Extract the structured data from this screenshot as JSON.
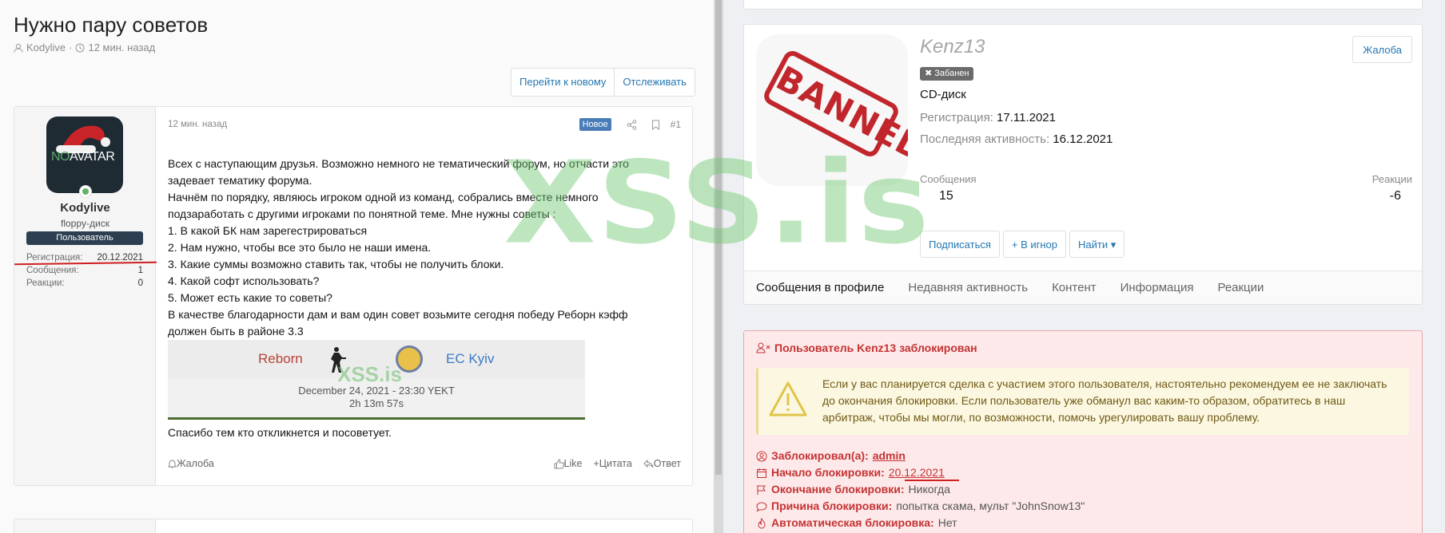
{
  "thread": {
    "title": "Нужно пару советов",
    "author": "Kodylive",
    "time": "12 мин. назад",
    "buttons": {
      "goto_new": "Перейти к новому",
      "watch": "Отслеживать"
    }
  },
  "post": {
    "user": {
      "avatar_text_1": "NO",
      "avatar_text_2": "AVATAR",
      "name": "Kodylive",
      "title": "floppy-диск",
      "badge": "Пользователь",
      "stats": [
        {
          "label": "Регистрация:",
          "value": "20.12.2021"
        },
        {
          "label": "Сообщения:",
          "value": "1"
        },
        {
          "label": "Реакции:",
          "value": "0"
        }
      ]
    },
    "time": "12 мин. назад",
    "new_badge": "Новое",
    "number": "#1",
    "body_lines": [
      "Всех с наступающим друзья. Возможно немного не тематический форум, но отчасти это",
      "задевает тематику форума.",
      "Начнём по порядку, являюсь игроком одной из команд, собрались вместе немного",
      "подзаработать с другими игроками по понятной теме. Мне нужны советы :",
      "1. В какой БК нам зарегестрироваться",
      "2. Нам нужно, чтобы все это было не наши имена.",
      "3. Какие суммы возможно ставить так, чтобы не получить блоки.",
      "4. Какой софт использовать?",
      "5. Может есть какие то советы?",
      "В качестве благодарности дам и вам один совет возьмите сегодня победу Реборн кэфф",
      "должен быть в районе 3.3"
    ],
    "embed": {
      "team1": "Reborn",
      "team2": "EC Kyiv",
      "date": "December 24, 2021 - 23:30 YEKT",
      "countdown": "2h 13m 57s",
      "watermark": "XSS.is"
    },
    "closing": "Спасибо тем кто откликнется и посоветует.",
    "footer": {
      "report": "Жалоба",
      "like": "Like",
      "quote": "Цитата",
      "reply": "Ответ"
    }
  },
  "profile": {
    "name": "Kenz13",
    "banned_badge": "Забанен",
    "stamp": "BANNED",
    "title": "CD-диск",
    "registration_label": "Регистрация:",
    "registration": "17.11.2021",
    "last_activity_label": "Последняя активность:",
    "last_activity": "16.12.2021",
    "report_button": "Жалоба",
    "messages_label": "Сообщения",
    "messages": "15",
    "reactions_label": "Реакции",
    "reactions": "-6",
    "buttons": {
      "subscribe": "Подписаться",
      "ignore": "+ В игнор",
      "find": "Найти"
    },
    "tabs": [
      "Сообщения в профиле",
      "Недавняя активность",
      "Контент",
      "Информация",
      "Реакции"
    ]
  },
  "block": {
    "header": "Пользователь Kenz13 заблокирован",
    "warning": "Если у вас планируется сделка с участием этого пользователя, настоятельно рекомендуем ее не заключать до окончания блокировки. Если пользователь уже обманул вас каким-то образом, обратитесь в наш арбитраж, чтобы мы могли, по возможности, помочь урегулировать вашу проблему.",
    "blocked_by_label": "Заблокировал(а):",
    "blocked_by": "admin",
    "start_label": "Начало блокировки:",
    "start": "20.12.2021",
    "end_label": "Окончание блокировки:",
    "end": "Никогда",
    "reason_label": "Причина блокировки:",
    "reason": "попытка скама, мульт \"JohnSnow13\"",
    "auto_label": "Автоматическая блокировка:",
    "auto": "Нет"
  },
  "watermark": "XSS.is",
  "colors": {
    "accent": "#2577b1",
    "danger": "#c53333",
    "annotation": "#cf1f1f"
  }
}
